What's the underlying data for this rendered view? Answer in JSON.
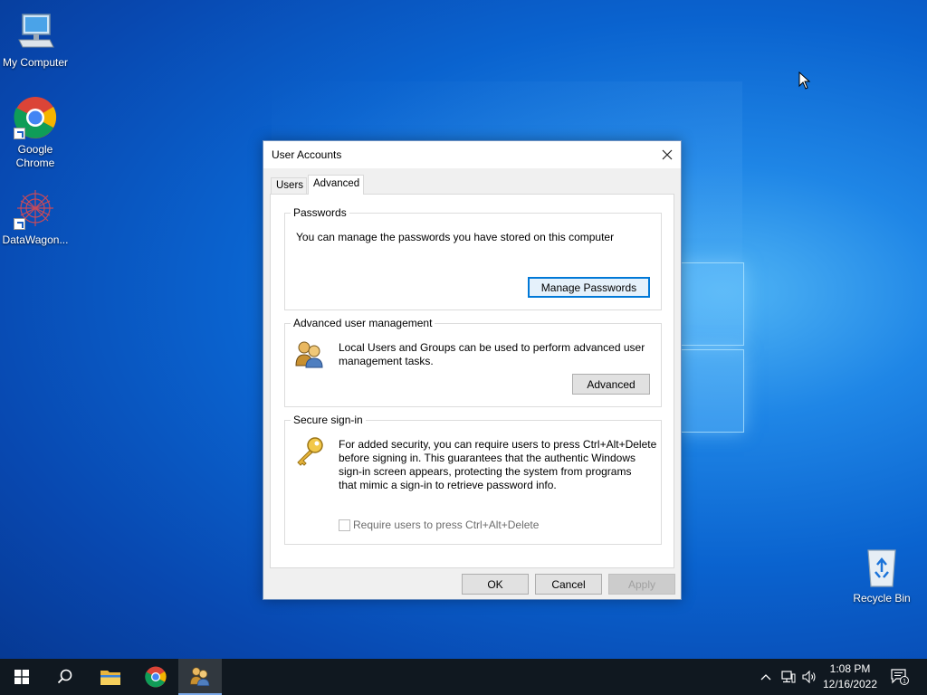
{
  "desktop": {
    "icons": [
      {
        "label": "My Computer"
      },
      {
        "label": "Google Chrome"
      },
      {
        "label": "DataWagon..."
      },
      {
        "label": "Recycle Bin"
      }
    ]
  },
  "dialog": {
    "title": "User Accounts",
    "tabs": [
      {
        "label": "Users"
      },
      {
        "label": "Advanced"
      }
    ],
    "passwords": {
      "legend": "Passwords",
      "text": "You can manage the passwords you have stored on this computer",
      "button": "Manage Passwords"
    },
    "advanced_mgmt": {
      "legend": "Advanced user management",
      "text_line1": "Local Users and Groups can be used to perform advanced user",
      "text_line2": "management tasks.",
      "button": "Advanced"
    },
    "secure_signin": {
      "legend": "Secure sign-in",
      "text_lines": [
        "For added security, you can require users to press Ctrl+Alt+Delete",
        "before signing in. This guarantees that the authentic Windows",
        "sign-in screen appears, protecting the system from programs",
        "that mimic a sign-in to retrieve password info."
      ],
      "checkbox_label": "Require users to press Ctrl+Alt+Delete",
      "checkbox_checked": false
    },
    "buttons": {
      "ok": "OK",
      "cancel": "Cancel",
      "apply": "Apply"
    }
  },
  "taskbar": {
    "time": "1:08 PM",
    "date": "12/16/2022",
    "notification_count": "1"
  }
}
